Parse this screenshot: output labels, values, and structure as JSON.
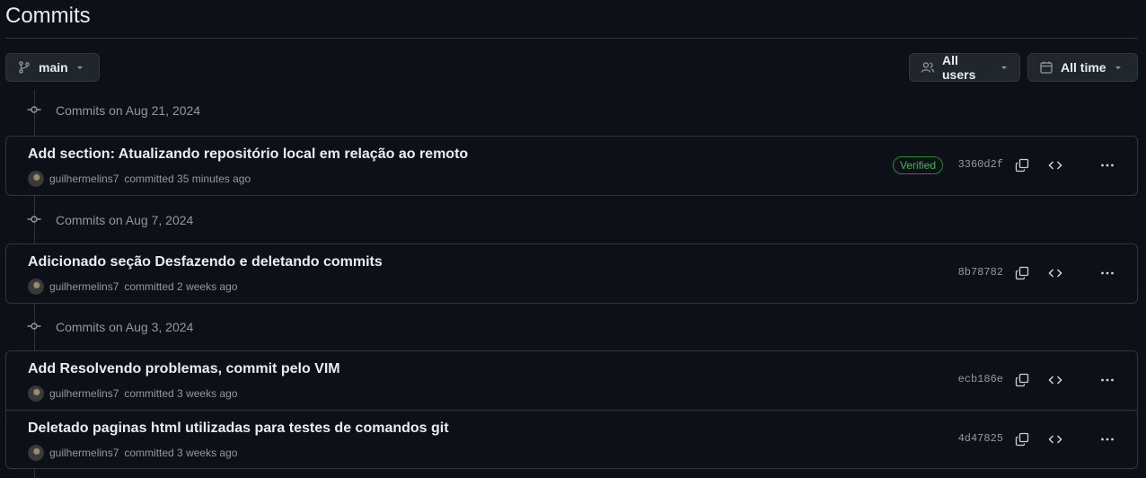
{
  "page": {
    "title": "Commits"
  },
  "toolbar": {
    "branch_label": "main",
    "users_label": "All users",
    "time_label": "All time"
  },
  "colors": {
    "background": "#0d1117",
    "border": "#30363d",
    "text": "#e6edf3",
    "muted": "#9198a1",
    "verified": "#3fb950"
  },
  "icons": {
    "branch": "git-branch-icon",
    "users": "people-icon",
    "time": "calendar-icon",
    "group": "git-commit-icon",
    "copy": "copy-icon",
    "browse": "code-icon",
    "more": "kebab-horizontal-icon"
  },
  "groups": [
    {
      "header": "Commits on Aug 21, 2024",
      "commits": [
        {
          "title": "Add section: Atualizando repositório local em relação ao remoto",
          "author": "guilhermelins7",
          "action": "committed 35 minutes ago",
          "verified": "Verified",
          "sha": "3360d2f"
        }
      ]
    },
    {
      "header": "Commits on Aug 7, 2024",
      "commits": [
        {
          "title": "Adicionado seção Desfazendo e deletando commits",
          "author": "guilhermelins7",
          "action": "committed 2 weeks ago",
          "sha": "8b78782"
        }
      ]
    },
    {
      "header": "Commits on Aug 3, 2024",
      "commits": [
        {
          "title": "Add Resolvendo problemas, commit pelo VIM",
          "author": "guilhermelins7",
          "action": "committed 3 weeks ago",
          "sha": "ecb186e"
        },
        {
          "title": "Deletado paginas html utilizadas para testes de comandos git",
          "author": "guilhermelins7",
          "action": "committed 3 weeks ago",
          "sha": "4d47825"
        }
      ]
    }
  ]
}
